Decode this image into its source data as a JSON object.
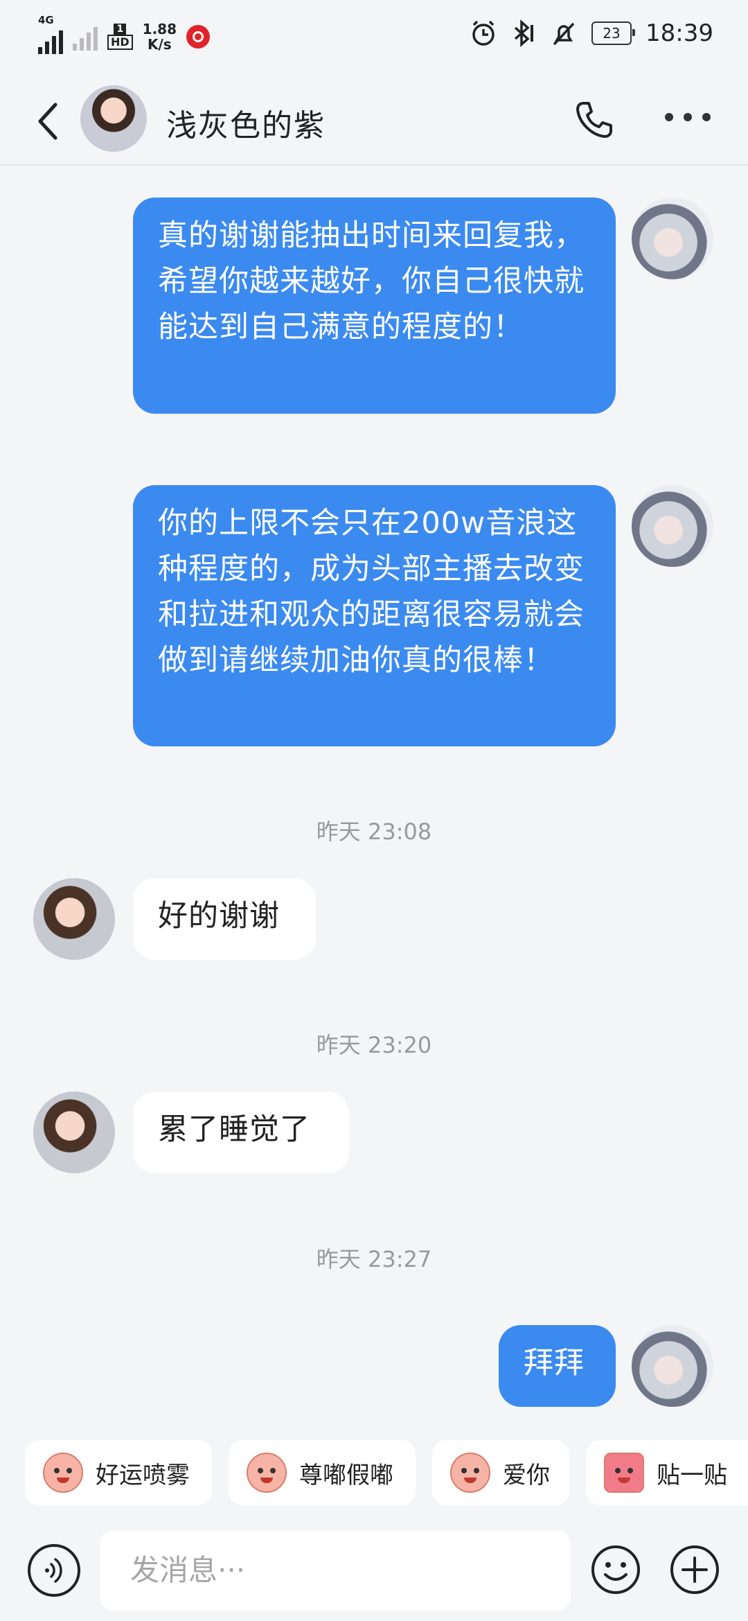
{
  "status_bar": {
    "network": "4G",
    "hd_box": "1",
    "hd_label": "HD",
    "speed_value": "1.88",
    "speed_unit": "K/s",
    "battery": "23",
    "time": "18:39"
  },
  "header": {
    "contact_name": "浅灰色的紫",
    "icons": [
      "back-arrow-icon",
      "phone-icon",
      "more-icon"
    ]
  },
  "messages": [
    {
      "side": "out",
      "text": "真的谢谢能抽出时间来回复我，希望你越来越好，你自己很快就能达到自己满意的程度的！"
    },
    {
      "side": "out",
      "text": "你的上限不会只在200w音浪这种程度的，成为头部主播去改变和拉进和观众的距离很容易就会做到请继续加油你真的很棒！"
    },
    {
      "timestamp": "昨天 23:08"
    },
    {
      "side": "in",
      "text": "好的谢谢"
    },
    {
      "timestamp": "昨天 23:20"
    },
    {
      "side": "in",
      "text": "累了睡觉了"
    },
    {
      "timestamp": "昨天 23:27"
    },
    {
      "side": "out",
      "text": "拜拜"
    }
  ],
  "quick_reactions": [
    "好运喷雾",
    "尊嘟假嘟",
    "爱你",
    "贴一贴"
  ],
  "input": {
    "placeholder": "发消息···"
  },
  "colors": {
    "outgoing_bubble": "#3b8af0",
    "incoming_bubble": "#ffffff",
    "background": "#f4f5f7"
  }
}
